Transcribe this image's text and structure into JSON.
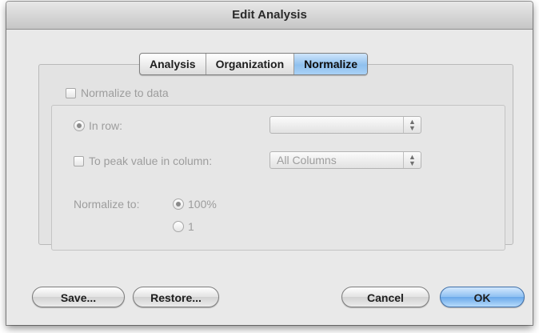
{
  "window": {
    "title": "Edit Analysis"
  },
  "tabs": [
    {
      "label": "Analysis",
      "selected": false
    },
    {
      "label": "Organization",
      "selected": false
    },
    {
      "label": "Normalize",
      "selected": true
    }
  ],
  "normalize_to_data": {
    "label": "Normalize to data",
    "checked": false
  },
  "in_row": {
    "label": "In row:",
    "selected": true,
    "popup_value": ""
  },
  "to_peak": {
    "label": "To peak value in column:",
    "selected": false,
    "popup_value": "All Columns"
  },
  "normalize_to": {
    "label": "Normalize to:",
    "options": [
      {
        "label": "100%",
        "selected": true
      },
      {
        "label": "1",
        "selected": false
      }
    ]
  },
  "buttons": {
    "save": "Save...",
    "restore": "Restore...",
    "cancel": "Cancel",
    "ok": "OK"
  },
  "colors": {
    "accent": "#8fc0ee",
    "disabled_text": "#9d9d9d"
  }
}
